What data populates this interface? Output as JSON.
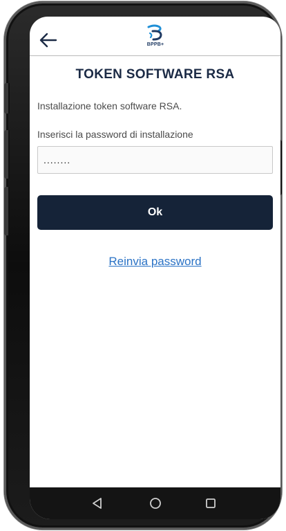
{
  "header": {
    "logo_text": "BPPB+",
    "back_icon": "arrow-left-icon",
    "logo_icon": "bppb-logo-icon"
  },
  "page": {
    "title": "TOKEN SOFTWARE RSA",
    "intro": "Installazione token software RSA.",
    "password_label": "Inserisci la password di installazione",
    "password_value": "........",
    "ok_label": "Ok",
    "resend_label": "Reinvia password"
  },
  "navbar": {
    "back_icon": "triangle-back-icon",
    "home_icon": "circle-home-icon",
    "recents_icon": "square-recents-icon"
  },
  "colors": {
    "primary": "#152338",
    "link": "#2a72c5",
    "title": "#1b2a45",
    "logo": "#1f8fd6"
  }
}
